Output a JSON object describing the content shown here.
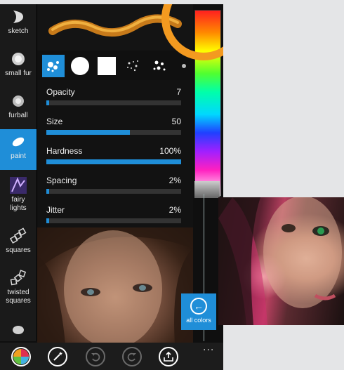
{
  "tools": [
    {
      "label": "sketch",
      "icon": "sketch-brush-icon"
    },
    {
      "label": "small fur",
      "icon": "small-fur-brush-icon"
    },
    {
      "label": "furball",
      "icon": "furball-brush-icon"
    },
    {
      "label": "paint",
      "icon": "paint-brush-icon",
      "active": true
    },
    {
      "label": "fairy\nlights",
      "icon": "fairy-lights-brush-icon"
    },
    {
      "label": "squares",
      "icon": "squares-brush-icon"
    },
    {
      "label": "twisted\nsquares",
      "icon": "twisted-squares-brush-icon"
    },
    {
      "label": "",
      "icon": "more-brush-icon"
    }
  ],
  "sliders": [
    {
      "name": "Opacity",
      "value": "7",
      "fraction": 0.02
    },
    {
      "name": "Size",
      "value": "50",
      "fraction": 0.62
    },
    {
      "name": "Hardness",
      "value": "100%",
      "fraction": 1.0
    },
    {
      "name": "Spacing",
      "value": "2%",
      "fraction": 0.02
    },
    {
      "name": "Jitter",
      "value": "2%",
      "fraction": 0.02
    }
  ],
  "all_colors": {
    "label": "all colors"
  },
  "more": "...",
  "colors": {
    "accent": "#1f8ed8",
    "ring": "#f39a20"
  }
}
